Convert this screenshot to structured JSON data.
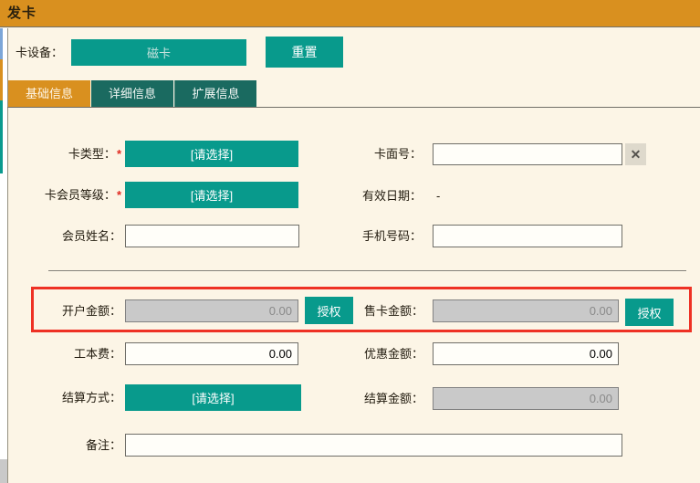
{
  "window": {
    "title": "发卡"
  },
  "toolbar": {
    "device_label": "卡设备：",
    "device_value": "磁卡",
    "reset_label": "重置"
  },
  "tabs": [
    {
      "label": "基础信息",
      "active": true
    },
    {
      "label": "详细信息",
      "active": false
    },
    {
      "label": "扩展信息",
      "active": false
    }
  ],
  "form": {
    "card_type": {
      "label": "卡类型：",
      "required": "*",
      "value": "[请选择]"
    },
    "card_face_no": {
      "label": "卡面号：",
      "value": "",
      "clear_icon": "✕"
    },
    "member_level": {
      "label": "卡会员等级：",
      "required": "*",
      "value": "[请选择]"
    },
    "valid_date": {
      "label": "有效日期：",
      "value": "-"
    },
    "member_name": {
      "label": "会员姓名：",
      "value": ""
    },
    "mobile": {
      "label": "手机号码：",
      "value": ""
    },
    "open_amount": {
      "label": "开户金额：",
      "value": "0.00",
      "authorize_label": "授权"
    },
    "sell_amount": {
      "label": "售卡金额：",
      "value": "0.00",
      "authorize_label": "授权"
    },
    "cost_fee": {
      "label": "工本费：",
      "value": "0.00"
    },
    "discount_amount": {
      "label": "优惠金额：",
      "value": "0.00"
    },
    "settle_method": {
      "label": "结算方式：",
      "value": "[请选择]"
    },
    "settle_amount": {
      "label": "结算金额：",
      "value": "0.00"
    },
    "remark": {
      "label": "备注：",
      "value": ""
    }
  },
  "colors": {
    "header_orange": "#D9901F",
    "accent_teal": "#089A8C",
    "tab_inactive_teal": "#1A6A60",
    "highlight_red": "#EE3124",
    "disabled_gray": "#C9C9C9",
    "page_cream": "#FCF5E6"
  }
}
